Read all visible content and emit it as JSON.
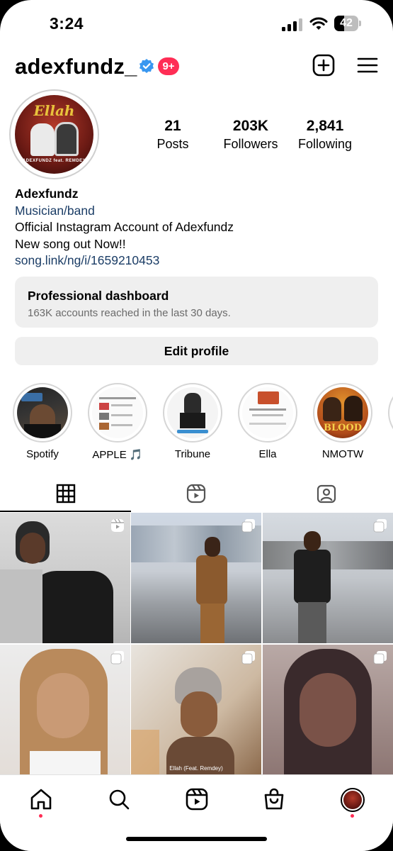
{
  "status_bar": {
    "time": "3:24",
    "battery": "42",
    "battery_level": 0.42
  },
  "header": {
    "username": "adexfundz_",
    "verified_icon": "verified-badge-icon",
    "notification_count": "9+",
    "add_icon": "plus-square-icon",
    "menu_icon": "hamburger-menu-icon"
  },
  "profile": {
    "avatar_art": {
      "title": "Ellah",
      "credit": "ADEXFUNDZ feat. REMDEY"
    },
    "stats": [
      {
        "number": "21",
        "label": "Posts"
      },
      {
        "number": "203K",
        "label": "Followers"
      },
      {
        "number": "2,841",
        "label": "Following"
      }
    ],
    "name": "Adexfundz",
    "category": "Musician/band",
    "bio_line1": "Official Instagram Account of Adexfundz",
    "bio_line2": "New song out Now!!",
    "link": "song.link/ng/i/1659210453"
  },
  "dashboard": {
    "title": "Professional dashboard",
    "subtitle": "163K accounts reached in the last 30 days."
  },
  "edit_profile_label": "Edit profile",
  "highlights": [
    {
      "label": "Spotify"
    },
    {
      "label": "APPLE 🎵"
    },
    {
      "label": "Tribune"
    },
    {
      "label": "Ella"
    },
    {
      "label": "NMOTW",
      "cover_text": "BLOOD"
    }
  ],
  "tabs": [
    {
      "icon": "grid-icon",
      "active": true
    },
    {
      "icon": "reels-icon",
      "active": false
    },
    {
      "icon": "tagged-icon",
      "active": false
    }
  ],
  "posts": [
    {
      "badge": "reel-icon"
    },
    {
      "badge": "carousel-icon"
    },
    {
      "badge": "carousel-icon"
    },
    {
      "badge": "carousel-icon"
    },
    {
      "badge": "carousel-icon",
      "caption": "Ellah (Feat. Remdey)"
    },
    {
      "badge": "carousel-icon"
    }
  ],
  "bottom_nav": [
    {
      "icon": "home-icon",
      "dot": true
    },
    {
      "icon": "search-icon"
    },
    {
      "icon": "reels-icon"
    },
    {
      "icon": "shop-bag-icon"
    },
    {
      "icon": "profile-avatar-icon",
      "dot": true
    }
  ],
  "colors": {
    "accent_link": "#1b3d66",
    "badge_red": "#ff2d55",
    "verified_blue": "#3897f0"
  }
}
